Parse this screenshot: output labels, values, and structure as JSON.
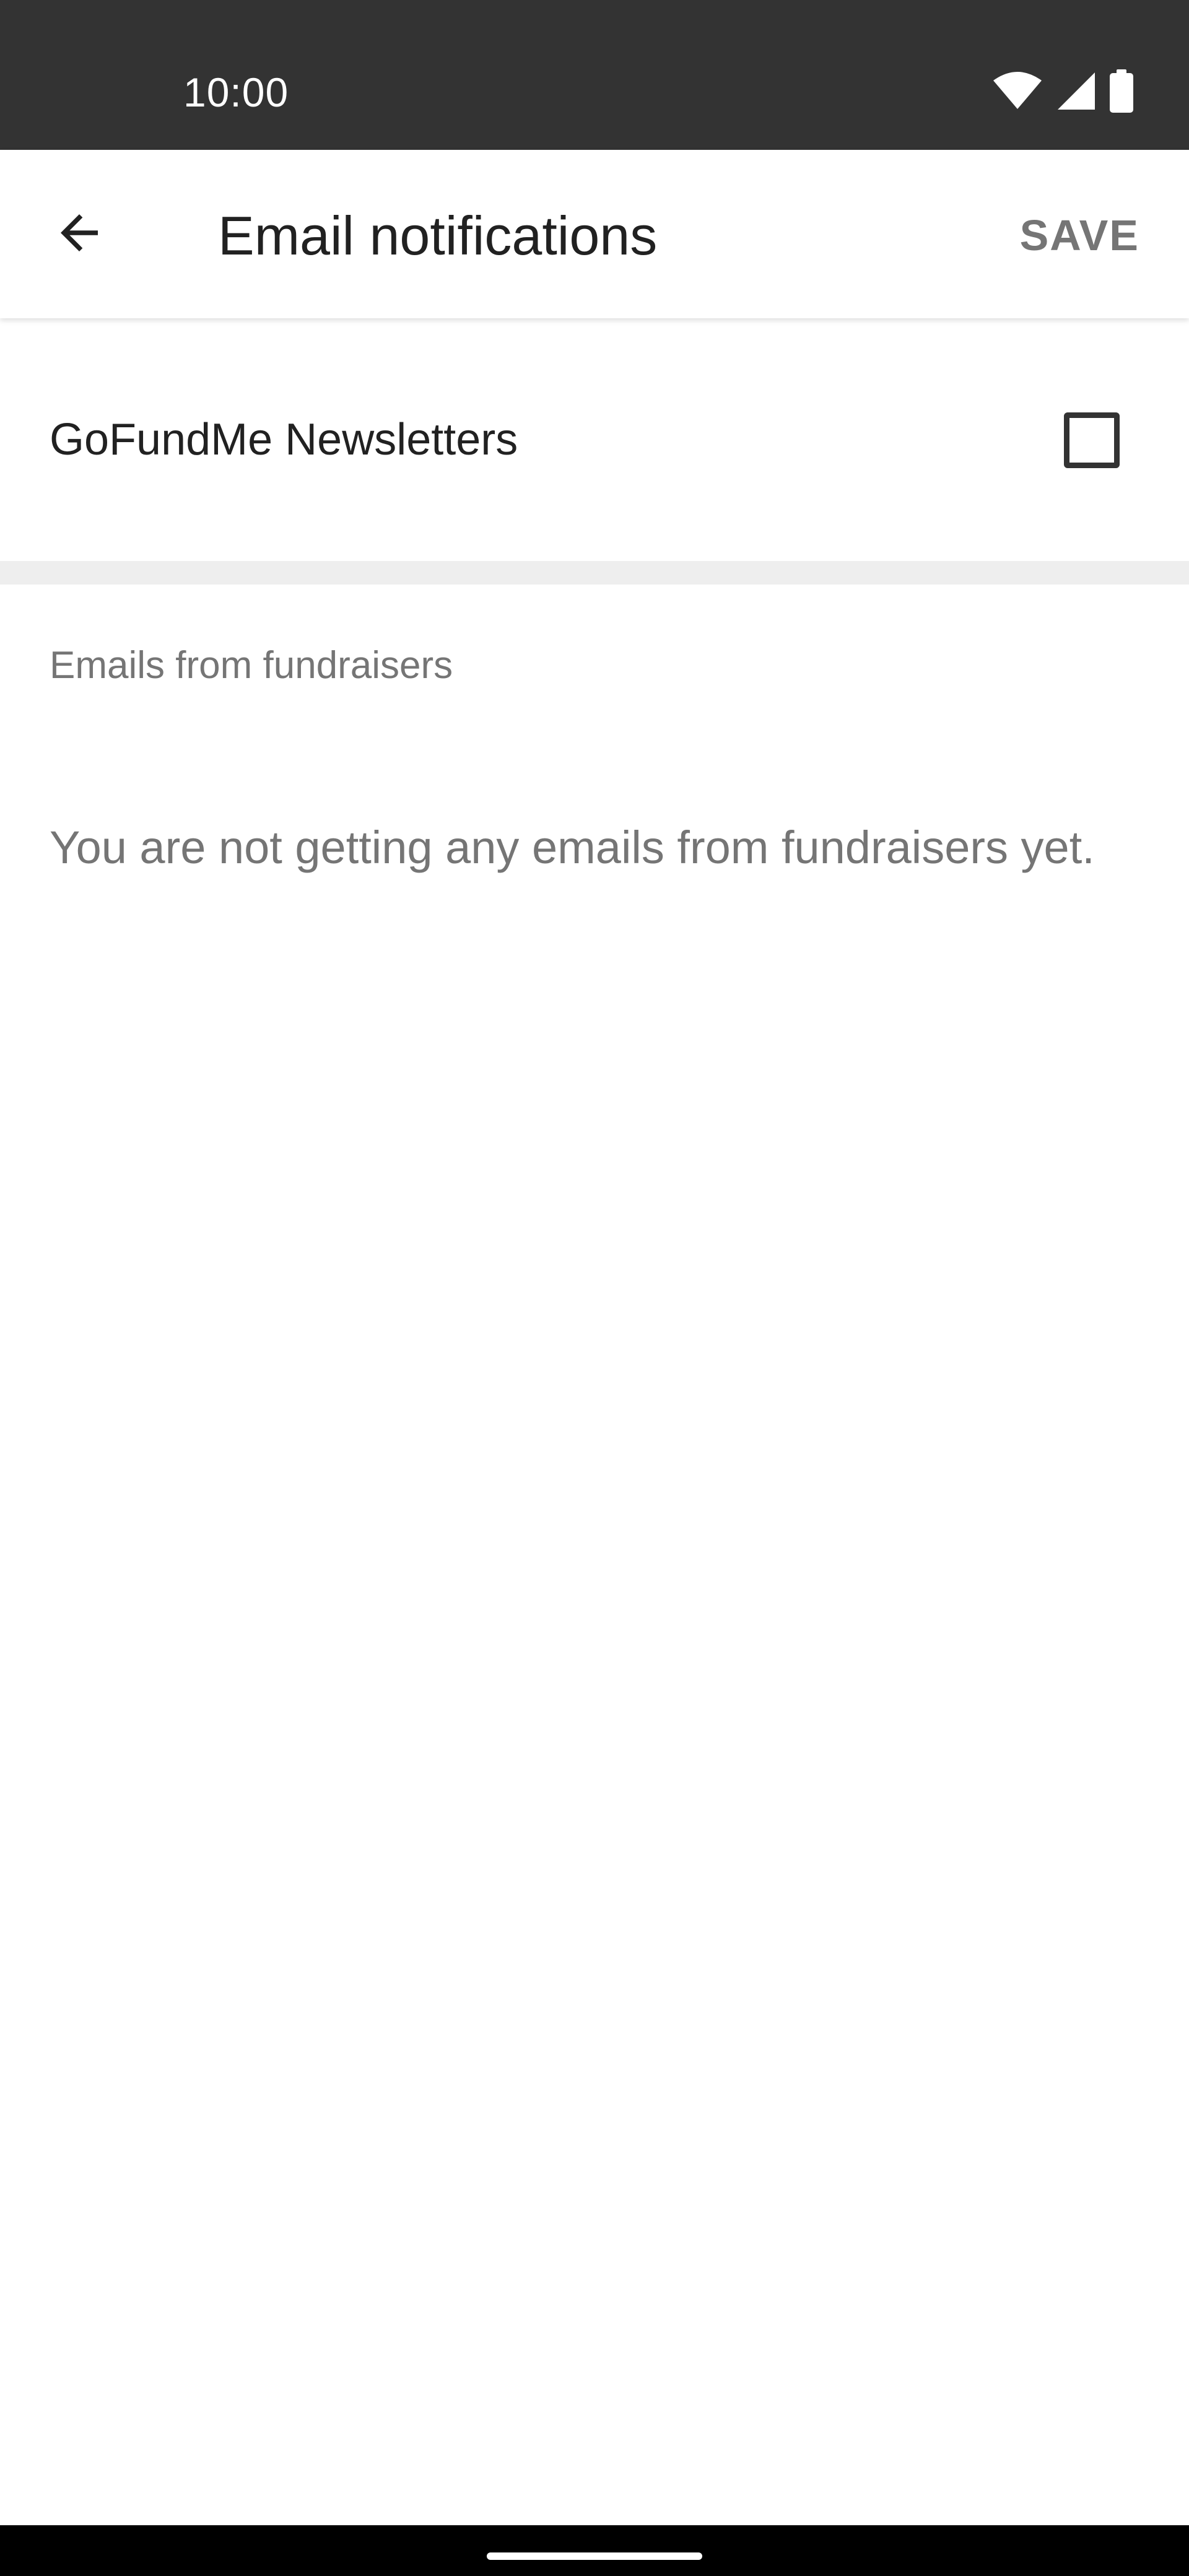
{
  "status_bar": {
    "time": "10:00",
    "icons": [
      "wifi-icon",
      "cellular-signal-icon",
      "battery-icon"
    ]
  },
  "app_bar": {
    "back_icon": "arrow-back-icon",
    "title": "Email notifications",
    "save_label": "SAVE"
  },
  "newsletter": {
    "label": "GoFundMe Newsletters",
    "checked": false
  },
  "fundraisers_section": {
    "header": "Emails from fundraisers",
    "empty_message": "You are not getting any emails from fundraisers yet."
  },
  "colors": {
    "status_bar_bg": "#333333",
    "title_text": "#212121",
    "secondary_text": "#757575",
    "divider": "#eeeeee"
  }
}
